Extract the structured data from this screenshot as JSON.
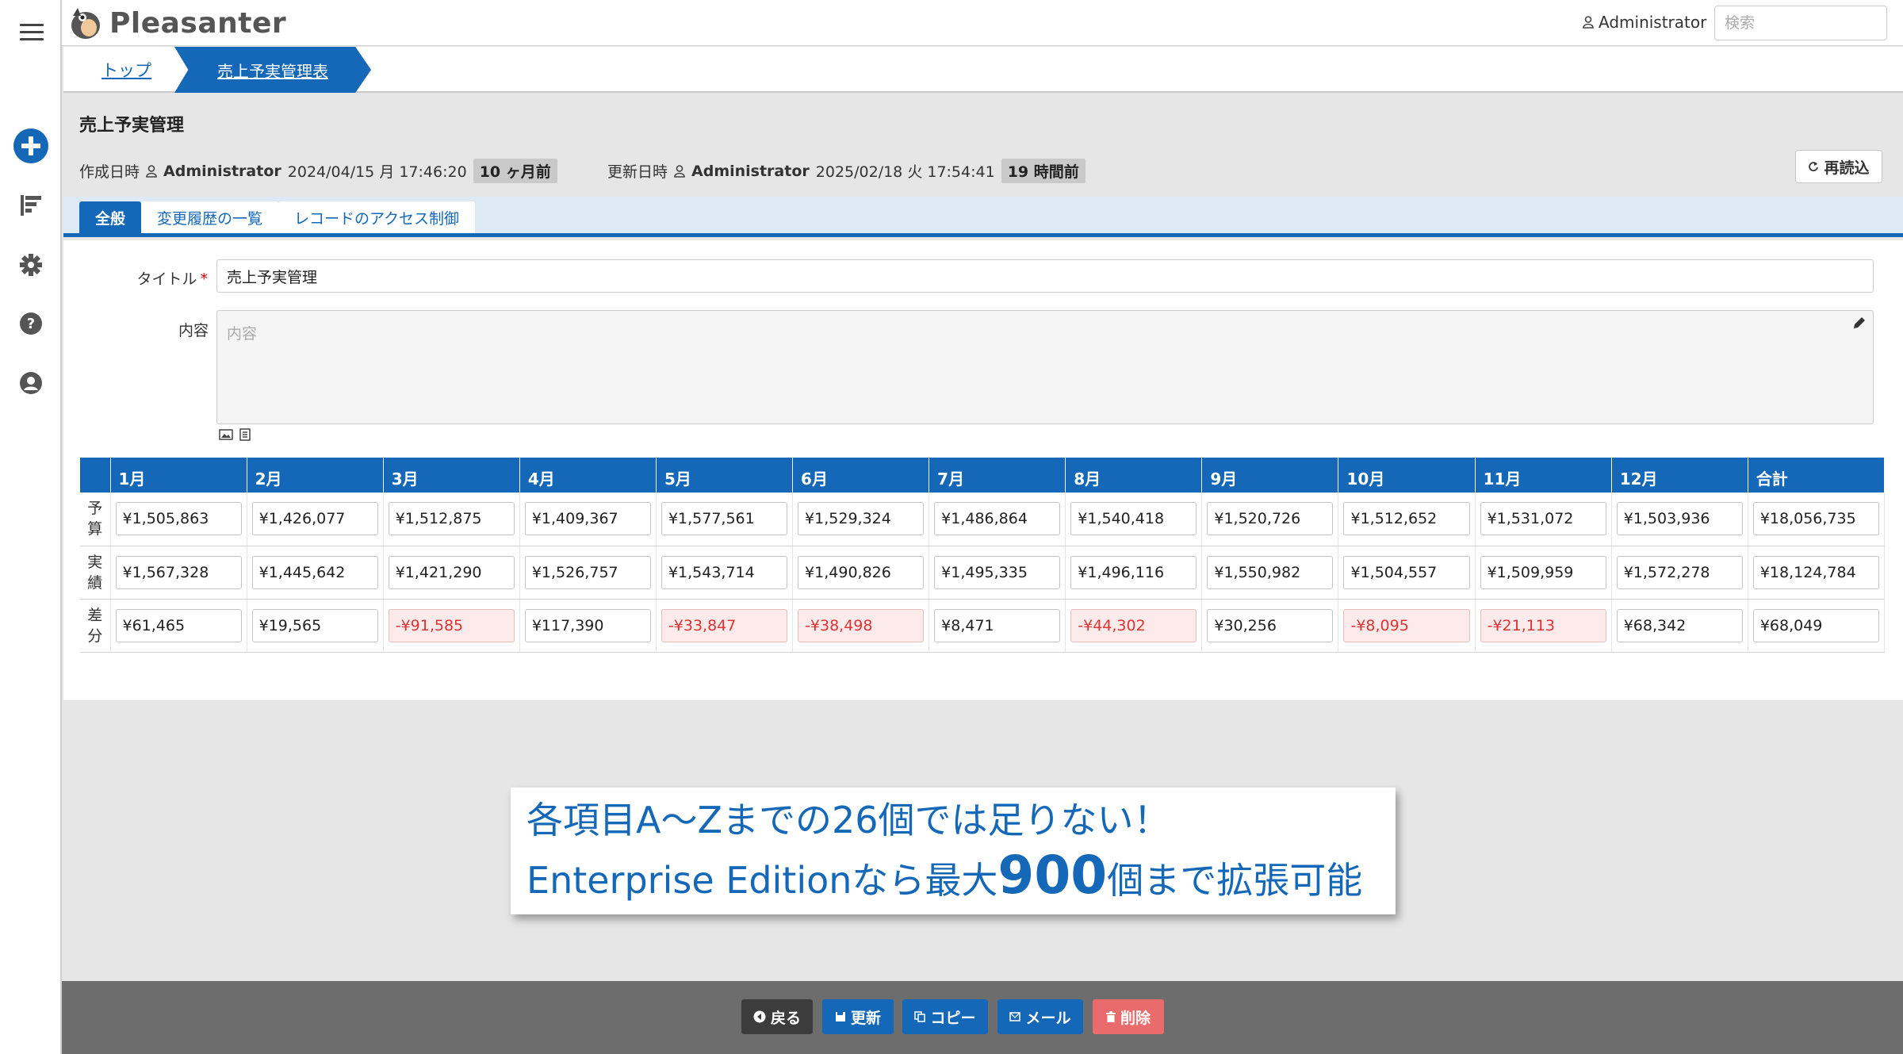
{
  "app": {
    "name": "Pleasanter"
  },
  "topbar": {
    "user": "Administrator",
    "search_placeholder": "検索"
  },
  "breadcrumb": {
    "top": "トップ",
    "current": "売上予実管理表"
  },
  "header": {
    "title": "売上予実管理",
    "created_label": "作成日時",
    "created_user": "Administrator",
    "created_at": "2024/04/15 月 17:46:20",
    "created_ago": "10 ヶ月前",
    "updated_label": "更新日時",
    "updated_user": "Administrator",
    "updated_at": "2025/02/18 火 17:54:41",
    "updated_ago": "19 時間前",
    "reload": "再読込"
  },
  "tabs": [
    "全般",
    "変更履歴の一覧",
    "レコードのアクセス制御"
  ],
  "form": {
    "title_label": "タイトル",
    "title_required": "*",
    "title_value": "売上予実管理",
    "body_label": "内容",
    "body_placeholder": "内容"
  },
  "grid": {
    "columns": [
      "1月",
      "2月",
      "3月",
      "4月",
      "5月",
      "6月",
      "7月",
      "8月",
      "9月",
      "10月",
      "11月",
      "12月",
      "合計"
    ],
    "rows": [
      {
        "label": [
          "予",
          "算"
        ],
        "values": [
          "¥1,505,863",
          "¥1,426,077",
          "¥1,512,875",
          "¥1,409,367",
          "¥1,577,561",
          "¥1,529,324",
          "¥1,486,864",
          "¥1,540,418",
          "¥1,520,726",
          "¥1,512,652",
          "¥1,531,072",
          "¥1,503,936",
          "¥18,056,735"
        ]
      },
      {
        "label": [
          "実",
          "績"
        ],
        "values": [
          "¥1,567,328",
          "¥1,445,642",
          "¥1,421,290",
          "¥1,526,757",
          "¥1,543,714",
          "¥1,490,826",
          "¥1,495,335",
          "¥1,496,116",
          "¥1,550,982",
          "¥1,504,557",
          "¥1,509,959",
          "¥1,572,278",
          "¥18,124,784"
        ]
      },
      {
        "label": [
          "差",
          "分"
        ],
        "values": [
          "¥61,465",
          "¥19,565",
          "-¥91,585",
          "¥117,390",
          "-¥33,847",
          "-¥38,498",
          "¥8,471",
          "-¥44,302",
          "¥30,256",
          "-¥8,095",
          "-¥21,113",
          "¥68,342",
          "¥68,049"
        ]
      }
    ]
  },
  "callout": {
    "line1": "各項目A～Zまでの26個では足りない！",
    "line2_pre": "Enterprise Editionなら最大",
    "line2_num": "900",
    "line2_post": "個まで拡張可能"
  },
  "footer": {
    "back": "戻る",
    "update": "更新",
    "copy": "コピー",
    "mail": "メール",
    "delete": "削除"
  },
  "colors": {
    "primary": "#1468b7",
    "negative_bg": "#fdeaea",
    "negative_text": "#e03434",
    "delete": "#ea6b6b"
  }
}
